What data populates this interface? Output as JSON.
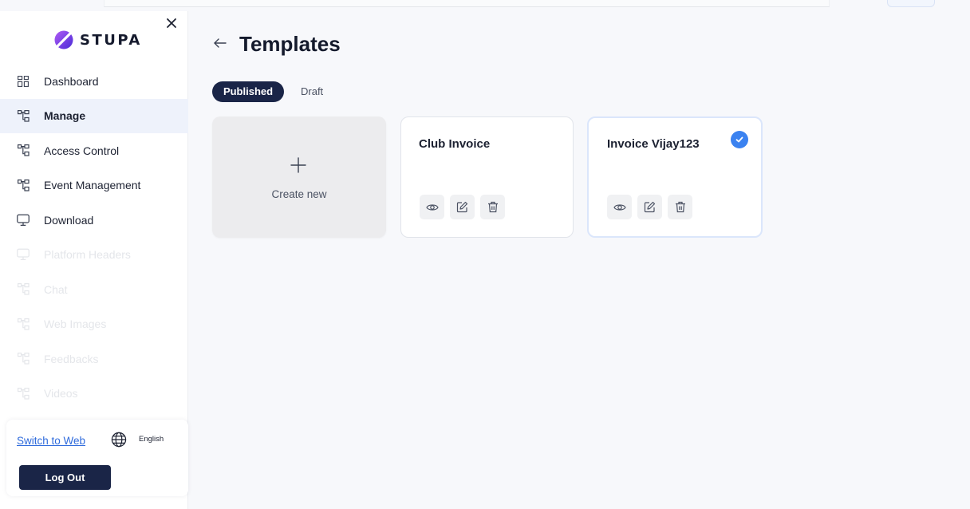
{
  "brand": {
    "name": "STUPA",
    "accent": "#7b3fe4"
  },
  "sidebar": {
    "items": [
      {
        "label": "Dashboard",
        "icon": "grid-icon",
        "state": "normal"
      },
      {
        "label": "Manage",
        "icon": "sitemap-icon",
        "state": "active"
      },
      {
        "label": "Access Control",
        "icon": "sitemap-icon",
        "state": "normal"
      },
      {
        "label": "Event Management",
        "icon": "sitemap-icon",
        "state": "normal"
      },
      {
        "label": "Download",
        "icon": "monitor-icon",
        "state": "normal"
      },
      {
        "label": "Platform Headers",
        "icon": "monitor-icon",
        "state": "faded"
      },
      {
        "label": "Chat",
        "icon": "sitemap-icon",
        "state": "faded"
      },
      {
        "label": "Web Images",
        "icon": "sitemap-icon",
        "state": "faded"
      },
      {
        "label": "Feedbacks",
        "icon": "sitemap-icon",
        "state": "faded"
      },
      {
        "label": "Videos",
        "icon": "sitemap-icon",
        "state": "faded"
      }
    ],
    "footer": {
      "switch_label": "Switch to Web",
      "language": "English",
      "logout_label": "Log Out"
    }
  },
  "main": {
    "title": "Templates",
    "tabs": [
      {
        "label": "Published",
        "active": true
      },
      {
        "label": "Draft",
        "active": false
      }
    ],
    "create_label": "Create new",
    "templates": [
      {
        "name": "Club Invoice",
        "selected": false
      },
      {
        "name": "Invoice Vijay123",
        "selected": true
      }
    ]
  },
  "colors": {
    "navy": "#1a2547",
    "selected_blue": "#3b82f0",
    "link": "#2f6bdc"
  }
}
